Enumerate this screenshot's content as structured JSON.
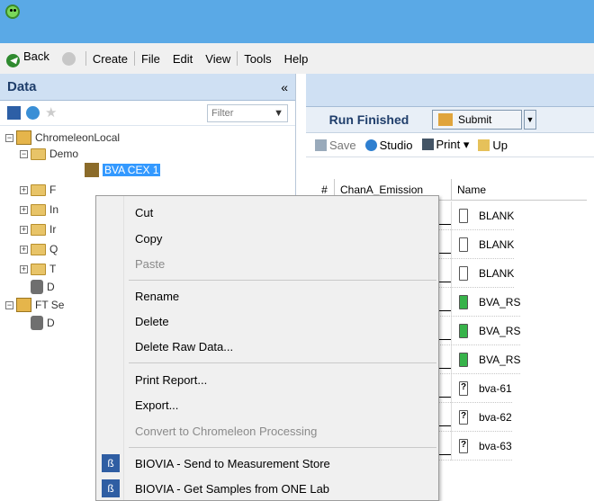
{
  "menubar": {
    "back": "Back",
    "create": "Create",
    "file": "File",
    "edit": "Edit",
    "view": "View",
    "tools": "Tools",
    "help": "Help"
  },
  "data_panel": {
    "title": "Data",
    "collapse": "«",
    "filter_placeholder": "Filter"
  },
  "tree": {
    "root": "ChromeleonLocal",
    "demo": "Demo",
    "selected_item": "BVA CEX 1",
    "items": [
      "F",
      "In",
      "Ir",
      "Q",
      "T",
      "D"
    ],
    "root2": "FT Se",
    "root2_child": "D"
  },
  "right_panel": {
    "status": "Run Finished",
    "submit": "Submit",
    "toolbar": {
      "save": "Save",
      "studio": "Studio",
      "print": "Print",
      "up": "Up"
    },
    "columns": {
      "num": "#",
      "chan": "ChanA_Emission",
      "name": "Name"
    },
    "rows": [
      {
        "name": "BLANK",
        "type": "blank"
      },
      {
        "name": "BLANK",
        "type": "blank"
      },
      {
        "name": "BLANK",
        "type": "blank"
      },
      {
        "name": "BVA_RS",
        "type": "std"
      },
      {
        "name": "BVA_RS",
        "type": "std"
      },
      {
        "name": "BVA_RS",
        "type": "std"
      },
      {
        "name": "bva-61",
        "type": "unk"
      },
      {
        "name": "bva-62",
        "type": "unk"
      },
      {
        "name": "bva-63",
        "type": "unk"
      }
    ]
  },
  "context_menu": {
    "cut": "Cut",
    "copy": "Copy",
    "paste": "Paste",
    "rename": "Rename",
    "delete": "Delete",
    "delete_raw": "Delete Raw Data...",
    "print_report": "Print Report...",
    "export": "Export...",
    "convert": "Convert to Chromeleon Processing",
    "biovia_send": "BIOVIA - Send to Measurement Store",
    "biovia_get": "BIOVIA - Get Samples from ONE Lab"
  },
  "colors": {
    "titlebar": "#5aa9e6",
    "panel_header": "#cfe0f3",
    "selection": "#3399ff"
  }
}
